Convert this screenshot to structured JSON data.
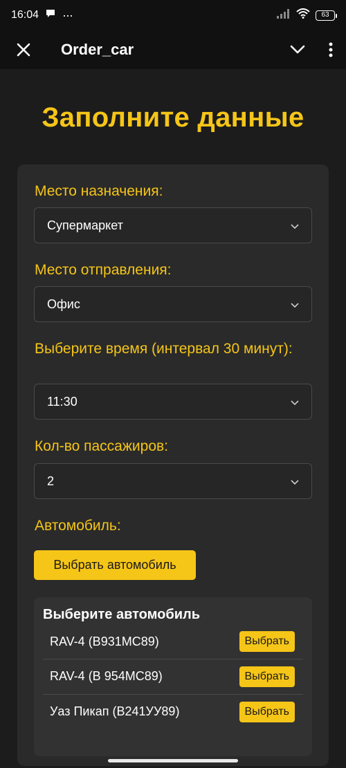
{
  "status_bar": {
    "time": "16:04",
    "dots": "···",
    "battery": "63"
  },
  "app_bar": {
    "title": "Order_car"
  },
  "page": {
    "heading": "Заполните данные"
  },
  "form": {
    "destination": {
      "label": "Место назначения:",
      "value": "Супермаркет"
    },
    "departure": {
      "label": "Место отправления:",
      "value": "Офис"
    },
    "time": {
      "label": "Выберите время (интервал 30 минут):",
      "value": "11:30"
    },
    "passengers": {
      "label": "Кол-во пассажиров:",
      "value": "2"
    },
    "car": {
      "label": "Автомобиль:",
      "button": "Выбрать автомобиль"
    }
  },
  "car_panel": {
    "title": "Выберите автомобиль",
    "cars": [
      {
        "name": "RAV-4 (В931МС89)",
        "button": "Выбрать"
      },
      {
        "name": "RAV-4 (В 954МС89)",
        "button": "Выбрать"
      },
      {
        "name": "Уаз Пикап (В241УУ89)",
        "button": "Выбрать"
      }
    ]
  },
  "colors": {
    "accent": "#f5c518",
    "background": "#1c1c1c",
    "card": "#2a2a2a"
  }
}
